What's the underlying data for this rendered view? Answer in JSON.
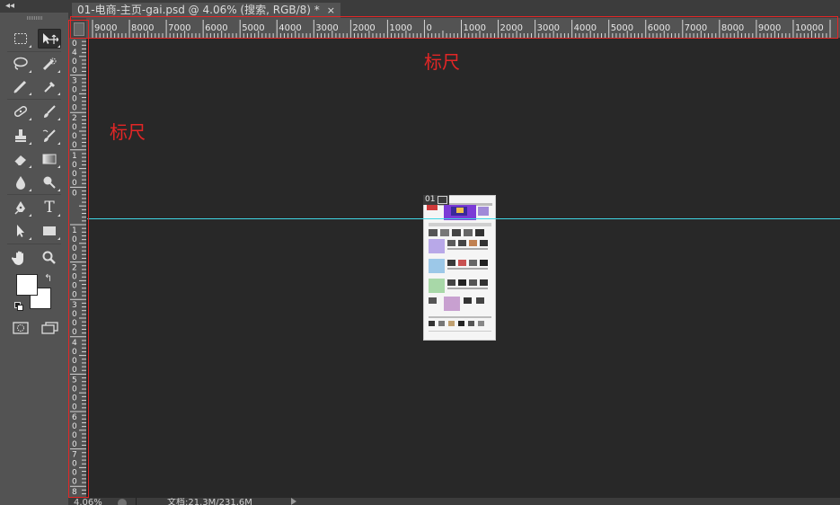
{
  "toolbox": {
    "collapse_icon": "double-chevron-left-icon",
    "tools": [
      {
        "name": "rect-marquee-tool",
        "icon": "rect-marquee-icon"
      },
      {
        "name": "move-tool",
        "icon": "move-icon",
        "selected": true
      },
      {
        "name": "lasso-tool",
        "icon": "lasso-icon"
      },
      {
        "name": "quick-select-tool",
        "icon": "quick-select-icon"
      },
      {
        "name": "crop-tool",
        "icon": "crop-icon"
      },
      {
        "name": "eyedropper-tool",
        "icon": "eyedropper-icon"
      },
      {
        "name": "healing-brush-tool",
        "icon": "bandage-icon"
      },
      {
        "name": "brush-tool",
        "icon": "brush-icon"
      },
      {
        "name": "clone-stamp-tool",
        "icon": "stamp-icon"
      },
      {
        "name": "history-brush-tool",
        "icon": "history-brush-icon"
      },
      {
        "name": "eraser-tool",
        "icon": "eraser-icon"
      },
      {
        "name": "gradient-tool",
        "icon": "gradient-icon"
      },
      {
        "name": "blur-tool",
        "icon": "drop-icon"
      },
      {
        "name": "dodge-tool",
        "icon": "dodge-icon"
      },
      {
        "name": "pen-tool",
        "icon": "pen-icon"
      },
      {
        "name": "type-tool",
        "icon": "type-icon",
        "glyph": "T"
      },
      {
        "name": "path-select-tool",
        "icon": "arrow-icon"
      },
      {
        "name": "rectangle-tool",
        "icon": "rectangle-icon"
      },
      {
        "name": "hand-tool",
        "icon": "hand-icon"
      },
      {
        "name": "zoom-tool",
        "icon": "magnifier-icon"
      }
    ],
    "foreground_color": "#ffffff",
    "background_color": "#ffffff"
  },
  "document": {
    "tab_title": "01-电商-主页-gai.psd @ 4.06% (搜索, RGB/8) *",
    "close_glyph": "×"
  },
  "rulers": {
    "horizontal_labels": [
      "9000",
      "8000",
      "7000",
      "6000",
      "5000",
      "4000",
      "3000",
      "2000",
      "1000",
      "0",
      "1000",
      "2000",
      "3000",
      "4000",
      "5000",
      "6000",
      "7000",
      "8000",
      "9000",
      "10000"
    ],
    "vertical_labels": [
      "0\n4\n0\n0",
      "3\n0\n0\n0",
      "2\n0\n0\n0",
      "1\n0\n0\n0",
      "0",
      "1\n0\n0\n0",
      "2\n0\n0\n0",
      "3\n0\n0\n0",
      "4\n0\n0\n0",
      "5\n0\n0\n0",
      "6\n0\n0\n0",
      "7\n0\n0\n0",
      "8"
    ]
  },
  "canvas": {
    "thumb_label": "01",
    "background": "#282828",
    "guide_color": "#3fd7e4"
  },
  "annotations": {
    "top_label": "标尺",
    "left_label": "标尺",
    "color": "#e32626"
  },
  "status": {
    "zoom": "4.06%",
    "doc_info": "文档:21.3M/231.6M"
  }
}
